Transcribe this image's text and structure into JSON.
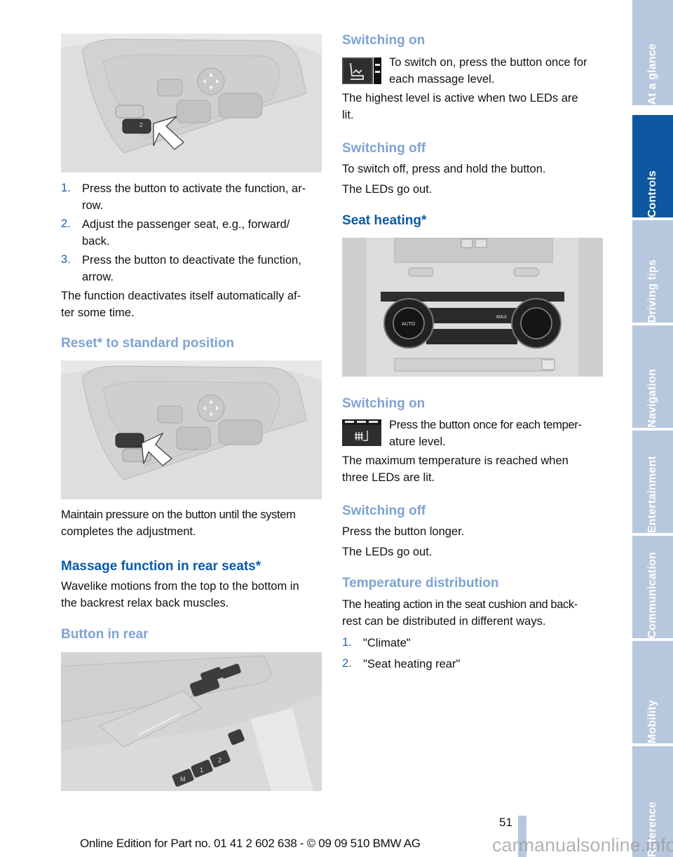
{
  "left": {
    "steps": [
      {
        "num": "1.",
        "lines": [
          "Press the button to activate the function, ar-",
          "row."
        ]
      },
      {
        "num": "2.",
        "lines": [
          "Adjust the passenger seat, e.g., forward/",
          "back."
        ]
      },
      {
        "num": "3.",
        "lines": [
          "Press the button to deactivate the function,",
          "arrow."
        ]
      }
    ],
    "auto_off": [
      "The function deactivates itself automatically af-",
      "ter some time."
    ],
    "reset_heading": "Reset* to standard position",
    "reset_text": [
      "Maintain pressure on the button until the system",
      "completes the adjustment."
    ],
    "massage_heading": "Massage function in rear seats*",
    "massage_text": [
      "Wavelike motions from the top to the bottom in",
      "the backrest relax back muscles."
    ],
    "button_rear_heading": "Button in rear",
    "figures": {
      "seat_button_activate": {
        "badge": "2"
      },
      "memory_buttons": [
        "M",
        "1",
        "2"
      ]
    }
  },
  "right": {
    "massage_on_heading": "Switching on",
    "massage_on_text": [
      "To switch on, press the button once for",
      "each massage level."
    ],
    "massage_level_text": [
      "The highest level is active when two LEDs are",
      "lit."
    ],
    "massage_off_heading": "Switching off",
    "massage_off_text": "To switch off, press and hold the button.",
    "massage_leds_out": "The LEDs go out.",
    "seat_heating_heading": "Seat heating*",
    "climate_panel": {
      "auto_label": "AUTO",
      "max_label": "MAX"
    },
    "heat_on_heading": "Switching on",
    "heat_on_text": [
      "Press the button once for each temper-",
      "ature level."
    ],
    "heat_max_text": [
      "The maximum temperature is reached when",
      "three LEDs are lit."
    ],
    "heat_off_heading": "Switching off",
    "heat_off_text": "Press the button longer.",
    "heat_leds_out": "The LEDs go out.",
    "distribution_heading": "Temperature distribution",
    "distribution_text": [
      "The heating action in the seat cushion and back-",
      "rest can be distributed in different ways."
    ],
    "distribution_steps": [
      {
        "num": "1.",
        "text": "\"Climate\""
      },
      {
        "num": "2.",
        "text": "\"Seat heating rear\""
      }
    ]
  },
  "sidebar": {
    "tabs": [
      {
        "label": "At a glance",
        "active": false
      },
      {
        "label": "Controls",
        "active": true
      },
      {
        "label": "Driving tips",
        "active": false
      },
      {
        "label": "Navigation",
        "active": false
      },
      {
        "label": "Entertainment",
        "active": false
      },
      {
        "label": "Communication",
        "active": false
      },
      {
        "label": "Mobility",
        "active": false
      },
      {
        "label": "Reference",
        "active": false
      }
    ]
  },
  "footer": {
    "page_number": "51",
    "edition": "Online Edition for Part no. 01 41 2 602 638 - © 09 09 510 BMW AG",
    "watermark": "carmanualsonline.info"
  },
  "colors": {
    "heading_dark": "#0a5ba8",
    "heading_light": "#7ea3d2",
    "tab_inactive": "#b7c8de",
    "tab_active": "#0c57a0"
  }
}
